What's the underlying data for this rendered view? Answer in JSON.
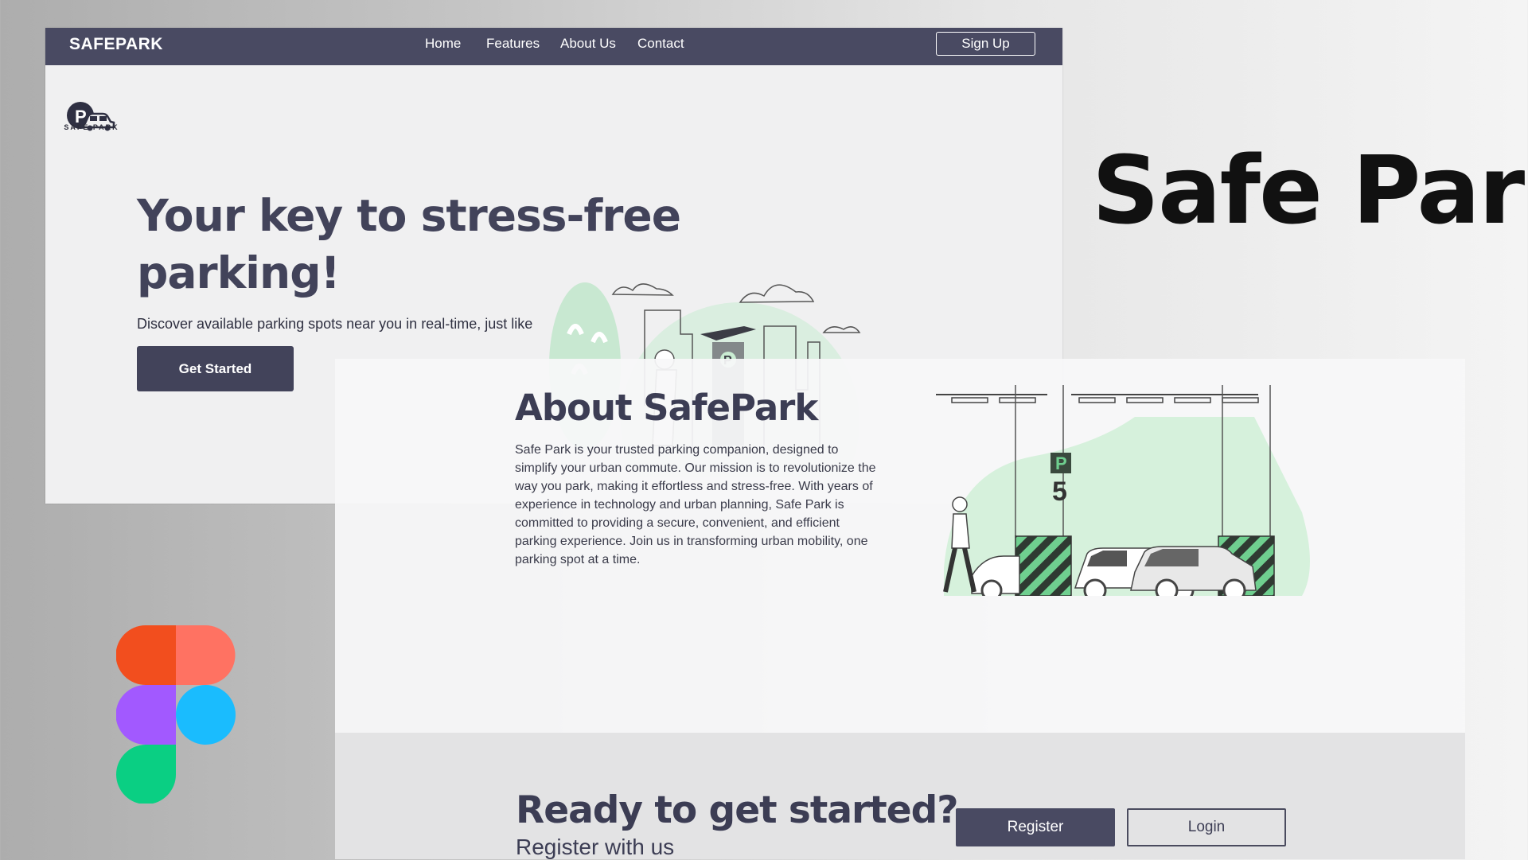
{
  "nav": {
    "brand": "SAFEPARK",
    "links": [
      "Home",
      "Features",
      "About Us",
      "Contact"
    ],
    "signup_label": "Sign Up"
  },
  "logo": {
    "text": "SAFE PARK"
  },
  "hero": {
    "title": "Your key to stress-free parking!",
    "subtitle": "Discover available parking spots near you in real-time, just like",
    "cta_label": "Get Started"
  },
  "heading": "Safe Park",
  "about": {
    "title": "About SafePark",
    "body": "Safe Park is your trusted parking companion, designed to simplify your urban commute. Our mission is to revolutionize the way you park, making it effortless and stress-free. With years of experience in technology and urban planning, Safe Park is committed to providing a secure, convenient, and efficient parking experience. Join us in transforming urban mobility, one parking spot at a time."
  },
  "cta": {
    "title": "Ready to get started?",
    "subtitle": "Register with us",
    "register_label": "Register",
    "login_label": "Login"
  },
  "colors": {
    "nav_bg": "#494a62",
    "heading_text": "#42435a",
    "accent_green": "#6fcf8f",
    "figma_red": "#f24e1e",
    "figma_salmon": "#ff7262",
    "figma_purple": "#a259ff",
    "figma_blue": "#1abcfe",
    "figma_green": "#0acf83"
  },
  "icons": {
    "parking_sign": "P",
    "parking_level": "5",
    "figma_logo": "figma-icon"
  }
}
